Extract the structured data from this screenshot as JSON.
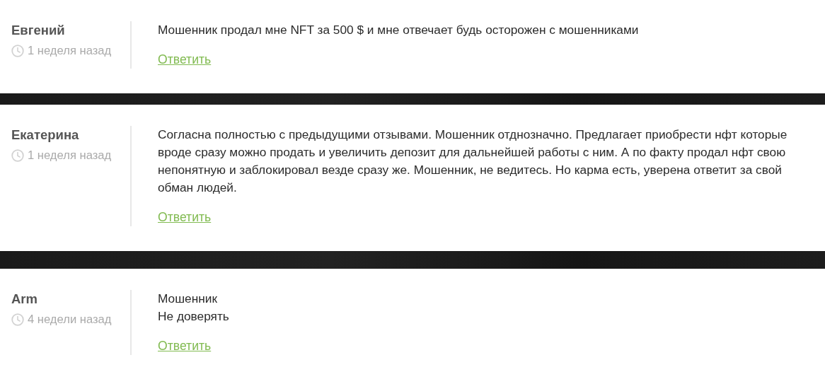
{
  "comments": [
    {
      "author": "Евгений",
      "time": "1 неделя назад",
      "text": [
        "Мошенник продал мне NFT за 500 $ и мне отвечает будь осторожен с мошенниками"
      ],
      "reply": "Ответить"
    },
    {
      "author": "Екатерина",
      "time": "1 неделя назад",
      "text": [
        "Согласна полностью с предыдущими отзывами. Мошенник отднозначно. Предлагает приобрести нфт которые вроде сразу можно продать и увеличить депозит для дальнейшей работы с ним. А по факту продал нфт свою непонятную и заблокировал везде сразу же. Мошенник, не ведитесь. Но карма есть, уверена ответит за свой обман людей."
      ],
      "reply": "Ответить"
    },
    {
      "author": "Arm",
      "time": "4 недели назад",
      "text": [
        "Мошенник",
        "Не доверять"
      ],
      "reply": "Ответить"
    }
  ]
}
